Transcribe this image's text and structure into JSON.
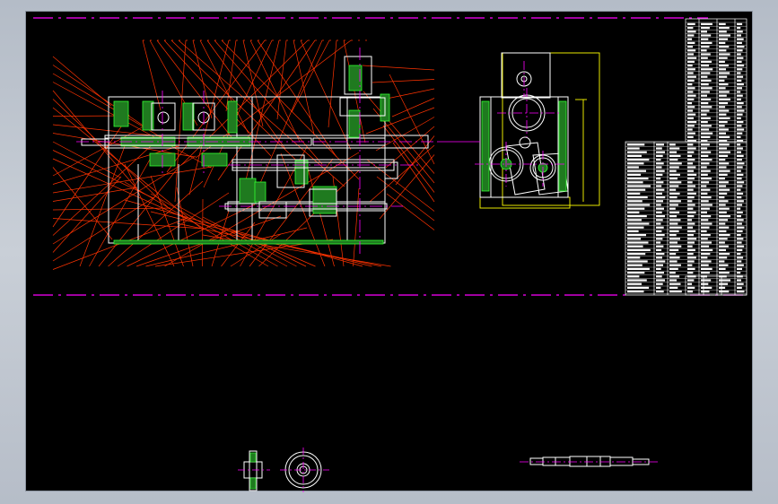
{
  "drawing": {
    "colors": {
      "background": "#000000",
      "outline": "#ffffff",
      "section_hatch": "#33ff33",
      "leader": "#ff3300",
      "centerline": "#ff00ff",
      "hidden_box": "#ffff00",
      "text": "#ffffff"
    },
    "views": [
      "main-assembly-section",
      "side-gear-view",
      "title-block-and-parts-list",
      "detail-gear-front",
      "detail-gear-side",
      "detail-shaft"
    ]
  }
}
